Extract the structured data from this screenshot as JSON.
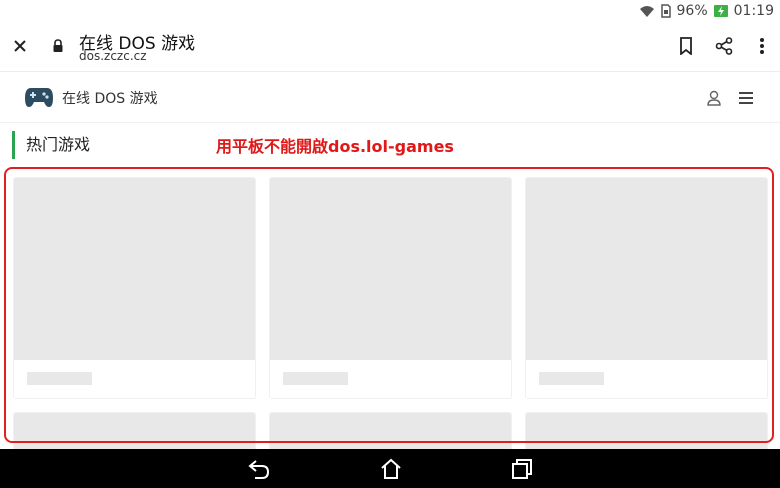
{
  "status_bar": {
    "battery": "96%",
    "time": "01:19",
    "icons": [
      "wifi-icon",
      "sim-icon",
      "battery-charging-icon"
    ]
  },
  "browser": {
    "page_title": "在线 DOS 游戏",
    "url": "dos.zczc.cz",
    "icons": [
      "close-icon",
      "lock-icon",
      "bookmark-icon",
      "share-icon",
      "more-vertical-icon"
    ]
  },
  "site": {
    "name": "在线 DOS 游戏",
    "icons": [
      "gamepad-icon",
      "user-icon",
      "menu-icon"
    ]
  },
  "section": {
    "title": "热门游戏"
  },
  "annotation": {
    "text": "用平板不能開啟dos.lol-games",
    "color": "#e01818"
  },
  "colors": {
    "accent": "#2aa44f",
    "highlight": "#e02020",
    "placeholder": "#e8e8e8"
  },
  "navigation": {
    "icons": [
      "back-icon",
      "home-icon",
      "recent-apps-icon"
    ]
  }
}
